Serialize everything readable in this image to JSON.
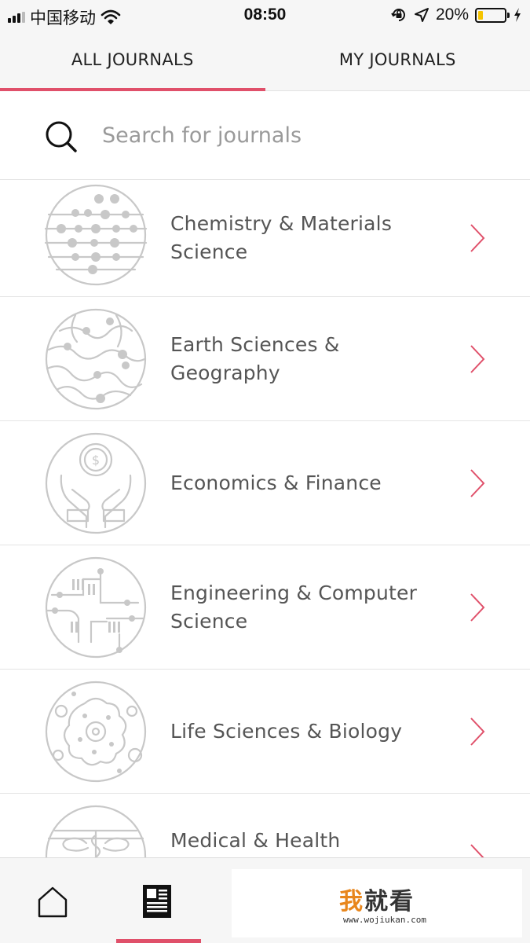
{
  "status_bar": {
    "carrier": "中国移动",
    "time": "08:50",
    "battery_percent": "20%",
    "battery_level": 0.2,
    "icons": [
      "signal-icon",
      "wifi-icon",
      "orientation-lock-icon",
      "location-icon",
      "battery-icon",
      "charging-icon"
    ]
  },
  "tabs": [
    {
      "label": "ALL JOURNALS",
      "active": true
    },
    {
      "label": "MY JOURNALS",
      "active": false
    }
  ],
  "search": {
    "placeholder": "Search for journals",
    "value": "",
    "icon": "search-icon"
  },
  "categories": [
    {
      "label": "Chemistry & Materials Science",
      "icon": "chemistry-icon"
    },
    {
      "label": "Earth Sciences & Geography",
      "icon": "earth-icon"
    },
    {
      "label": "Economics & Finance",
      "icon": "economics-icon"
    },
    {
      "label": "Engineering & Computer Science",
      "icon": "engineering-icon"
    },
    {
      "label": "Life Sciences & Biology",
      "icon": "biology-icon"
    },
    {
      "label": "Medical & Health",
      "icon": "medical-icon"
    }
  ],
  "bottom_nav": {
    "items": [
      {
        "icon": "home-icon",
        "active": false
      },
      {
        "icon": "journals-icon",
        "active": true
      }
    ]
  },
  "ad": {
    "brand_accent": "我",
    "brand_rest": "就看",
    "url": "www.wojiukan.com"
  },
  "colors": {
    "accent": "#e0506a",
    "illustration": "#c8c8c8",
    "ad_accent": "#e8861c"
  }
}
